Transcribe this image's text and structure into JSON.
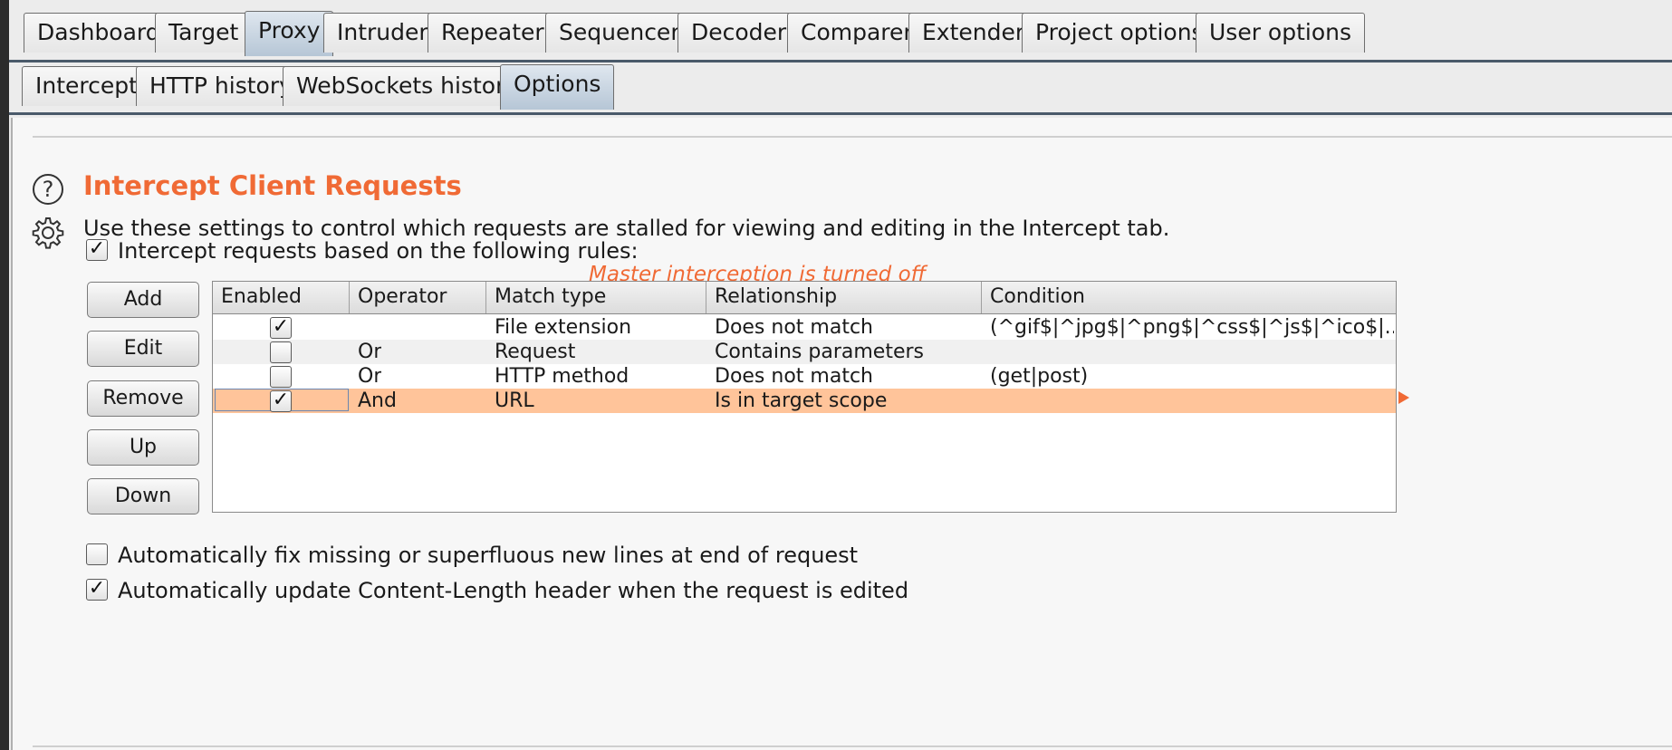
{
  "main_tabs": [
    "Dashboard",
    "Target",
    "Proxy",
    "Intruder",
    "Repeater",
    "Sequencer",
    "Decoder",
    "Comparer",
    "Extender",
    "Project options",
    "User options"
  ],
  "main_active": "Proxy",
  "sub_tabs": [
    "Intercept",
    "HTTP history",
    "WebSockets history",
    "Options"
  ],
  "sub_active": "Options",
  "section": {
    "help_icon_glyph": "?",
    "title": "Intercept Client Requests",
    "description": "Use these settings to control which requests are stalled for viewing and editing in the Intercept tab."
  },
  "intercept_rules": {
    "checkbox_label": "Intercept requests based on the following rules:",
    "checked": true,
    "status_note": "Master interception is turned off"
  },
  "buttons": {
    "add": "Add",
    "edit": "Edit",
    "remove": "Remove",
    "up": "Up",
    "down": "Down"
  },
  "table": {
    "columns": [
      "Enabled",
      "Operator",
      "Match type",
      "Relationship",
      "Condition"
    ],
    "rows": [
      {
        "enabled": true,
        "operator": "",
        "match_type": "File extension",
        "relationship": "Does not match",
        "condition": "(^gif$|^jpg$|^png$|^css$|^js$|^ico$|..."
      },
      {
        "enabled": false,
        "operator": "Or",
        "match_type": "Request",
        "relationship": "Contains parameters",
        "condition": ""
      },
      {
        "enabled": false,
        "operator": "Or",
        "match_type": "HTTP method",
        "relationship": "Does not match",
        "condition": "(get|post)"
      },
      {
        "enabled": true,
        "operator": "And",
        "match_type": "URL",
        "relationship": "Is in target scope",
        "condition": ""
      }
    ],
    "selected_row": 3
  },
  "options": [
    {
      "label": "Automatically fix missing or superfluous new lines at end of request",
      "checked": false
    },
    {
      "label": "Automatically update Content-Length header when the request is edited",
      "checked": true
    }
  ],
  "check_glyph": "✓",
  "colors": {
    "accent": "#f06a35",
    "selected_row": "#ffc49a"
  }
}
